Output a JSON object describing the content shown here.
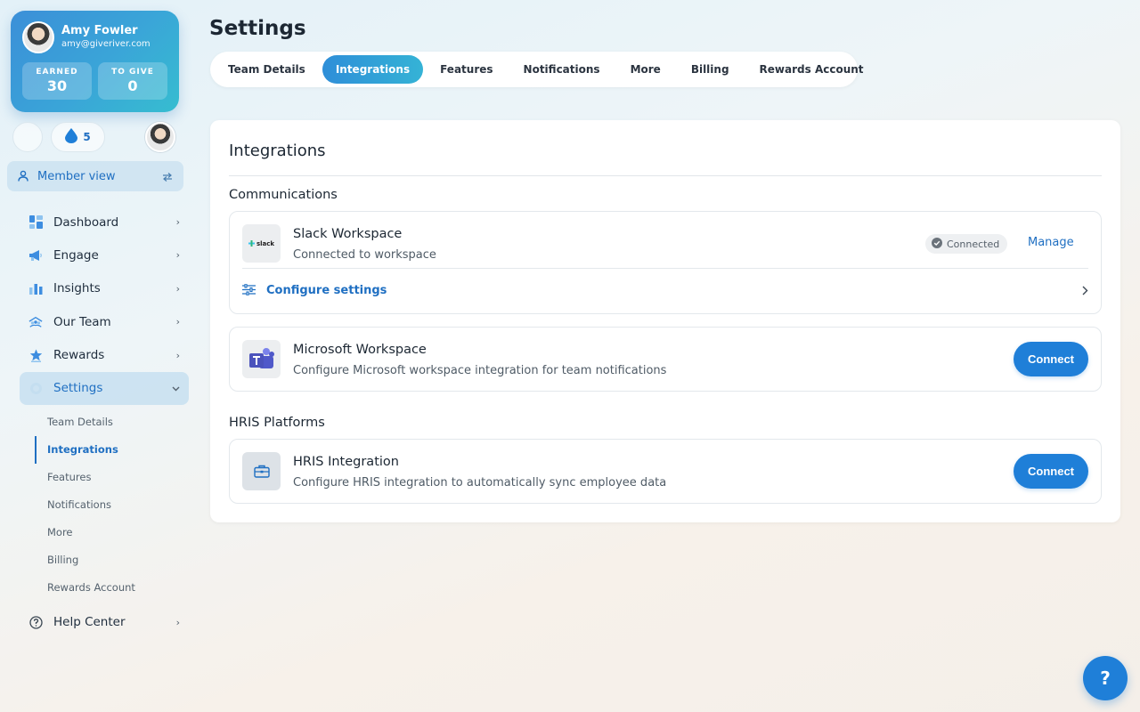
{
  "profile": {
    "name": "Amy Fowler",
    "email": "amy@giveriver.com",
    "earned_label": "EARNED",
    "earned_value": "30",
    "to_give_label": "TO GIVE",
    "to_give_value": "0"
  },
  "mini": {
    "drops": "5"
  },
  "member_view": {
    "label": "Member view"
  },
  "nav": {
    "items": [
      {
        "label": "Dashboard",
        "icon": "dashboard-icon"
      },
      {
        "label": "Engage",
        "icon": "megaphone-icon"
      },
      {
        "label": "Insights",
        "icon": "bar-chart-icon"
      },
      {
        "label": "Our Team",
        "icon": "team-icon"
      },
      {
        "label": "Rewards",
        "icon": "star-icon"
      },
      {
        "label": "Settings",
        "icon": "gear-icon"
      }
    ],
    "sub_items": [
      "Team Details",
      "Integrations",
      "Features",
      "Notifications",
      "More",
      "Billing",
      "Rewards Account"
    ],
    "help": {
      "label": "Help Center",
      "icon": "help-circle-icon"
    }
  },
  "page": {
    "title": "Settings"
  },
  "tabs": [
    "Team Details",
    "Integrations",
    "Features",
    "Notifications",
    "More",
    "Billing",
    "Rewards Account"
  ],
  "panel": {
    "title": "Integrations",
    "communications": {
      "heading": "Communications",
      "slack": {
        "logo_text": "slack",
        "title": "Slack Workspace",
        "desc": "Connected to workspace",
        "badge": "Connected",
        "manage": "Manage",
        "configure": "Configure settings"
      },
      "microsoft": {
        "title": "Microsoft Workspace",
        "desc": "Configure Microsoft workspace integration for team notifications",
        "connect": "Connect"
      }
    },
    "hris": {
      "heading": "HRIS Platforms",
      "integration": {
        "title": "HRIS Integration",
        "desc": "Configure HRIS integration to automatically sync employee data",
        "connect": "Connect"
      }
    }
  },
  "help_fab": "?",
  "colors": {
    "accent": "#1f7fd8",
    "link": "#1f6fc2",
    "gradient_start": "#3b8fd8",
    "gradient_end": "#36bdd0"
  }
}
